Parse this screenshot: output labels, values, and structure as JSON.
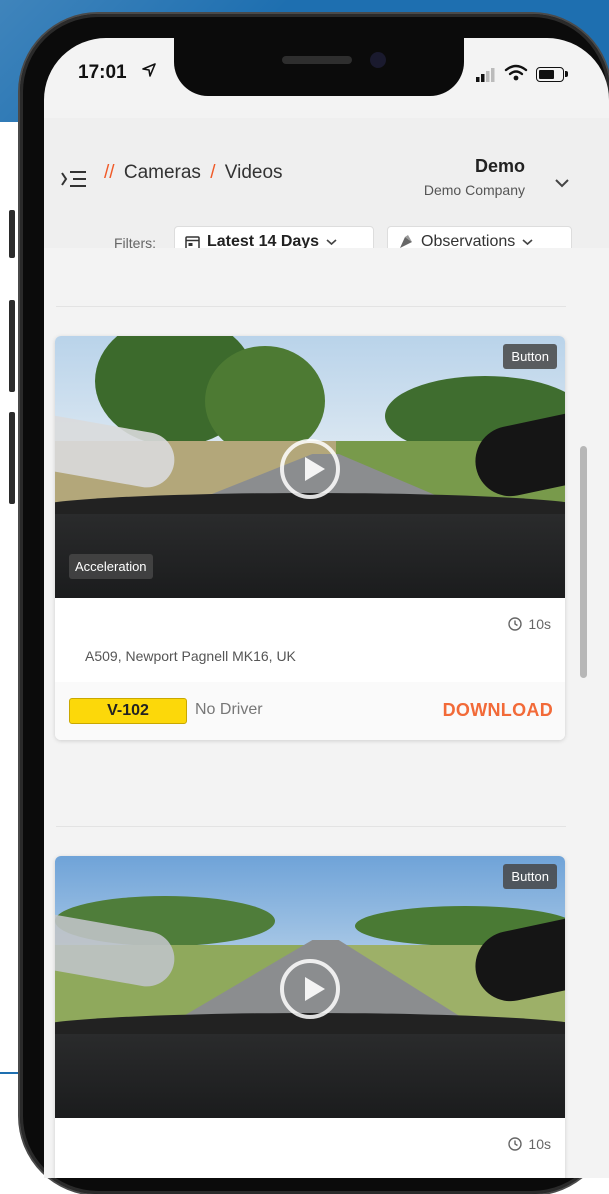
{
  "status_bar": {
    "time": "17:01"
  },
  "header": {
    "breadcrumb_prefix": "//",
    "breadcrumb_section": "Cameras",
    "breadcrumb_separator": "/",
    "breadcrumb_page": "Videos",
    "user_name": "Demo",
    "company": "Demo Company"
  },
  "filters": {
    "label": "Filters:",
    "date_range": "Latest 14 Days",
    "observations": "Observations"
  },
  "videos": [
    {
      "trigger_tag": "Button",
      "event_tag": "Acceleration",
      "duration": "10s",
      "address": "A509, Newport Pagnell MK16, UK",
      "vehicle": "V-102",
      "driver": "No Driver",
      "action": "DOWNLOAD"
    },
    {
      "trigger_tag": "Button",
      "duration": "10s"
    }
  ],
  "colors": {
    "accent": "#f26a38",
    "vehicle_tag": "#fcd80a",
    "backdrop": "#1e6fb0"
  }
}
